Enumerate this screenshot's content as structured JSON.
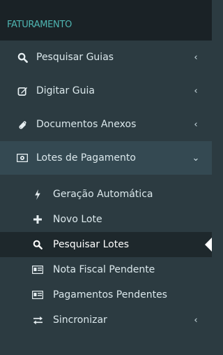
{
  "section_header": "FATURAMENTO",
  "menu": [
    {
      "label": "Pesquisar Guias",
      "icon": "search-icon",
      "arrow": "‹"
    },
    {
      "label": "Digitar Guia",
      "icon": "edit-icon",
      "arrow": "‹"
    },
    {
      "label": "Documentos Anexos",
      "icon": "paperclip-icon",
      "arrow": "‹"
    },
    {
      "label": "Lotes de Pagamento",
      "icon": "money-icon",
      "arrow": "⌄"
    }
  ],
  "submenu": [
    {
      "label": "Geração Automática",
      "icon": "bolt-icon"
    },
    {
      "label": "Novo Lote",
      "icon": "plus-icon"
    },
    {
      "label": "Pesquisar Lotes",
      "icon": "search-icon",
      "active": true
    },
    {
      "label": "Nota Fiscal Pendente",
      "icon": "id-card-icon"
    },
    {
      "label": "Pagamentos Pendentes",
      "icon": "id-card-icon"
    },
    {
      "label": "Sincronizar",
      "icon": "exchange-icon",
      "arrow": "‹"
    }
  ],
  "colors": {
    "header_text": "#4fb5b1",
    "sidebar_bg": "#2c3b41",
    "active_bg": "#1e282c"
  }
}
